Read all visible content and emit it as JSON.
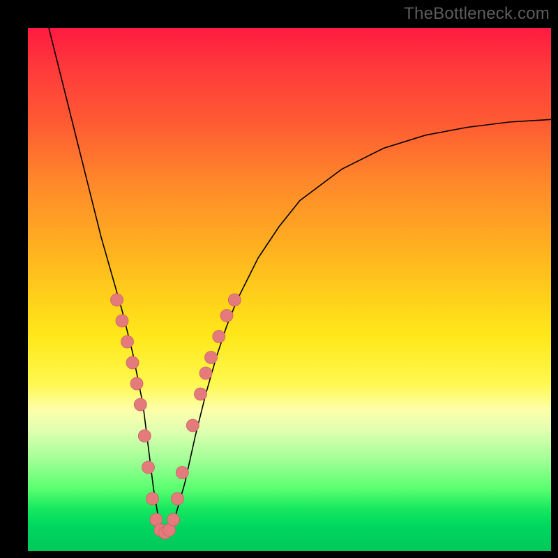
{
  "watermark": "TheBottleneck.com",
  "chart_data": {
    "type": "line",
    "title": "",
    "xlabel": "",
    "ylabel": "",
    "xlim": [
      0,
      100
    ],
    "ylim": [
      0,
      100
    ],
    "series": [
      {
        "name": "curve",
        "x": [
          4,
          6,
          8,
          10,
          12,
          14,
          16,
          18,
          20,
          22,
          23,
          24,
          25,
          26,
          27,
          28,
          30,
          32,
          34,
          36,
          38,
          40,
          44,
          48,
          52,
          56,
          60,
          68,
          76,
          84,
          92,
          100
        ],
        "y": [
          100,
          92,
          84,
          76,
          68,
          60,
          53,
          46,
          38,
          28,
          20,
          12,
          6,
          3,
          3,
          6,
          13,
          22,
          30,
          37,
          43,
          48,
          56,
          62,
          67,
          70,
          73,
          77,
          79.5,
          81,
          82,
          82.5
        ]
      }
    ],
    "scatter": [
      {
        "name": "highlight-points",
        "points": [
          {
            "x": 17.0,
            "y": 48
          },
          {
            "x": 18.0,
            "y": 44
          },
          {
            "x": 19.0,
            "y": 40
          },
          {
            "x": 20.0,
            "y": 36
          },
          {
            "x": 20.8,
            "y": 32
          },
          {
            "x": 21.5,
            "y": 28
          },
          {
            "x": 22.3,
            "y": 22
          },
          {
            "x": 23.0,
            "y": 16
          },
          {
            "x": 23.8,
            "y": 10
          },
          {
            "x": 24.5,
            "y": 6
          },
          {
            "x": 25.3,
            "y": 4
          },
          {
            "x": 26.2,
            "y": 3.5
          },
          {
            "x": 27.0,
            "y": 4
          },
          {
            "x": 27.8,
            "y": 6
          },
          {
            "x": 28.6,
            "y": 10
          },
          {
            "x": 29.5,
            "y": 15
          },
          {
            "x": 31.5,
            "y": 24
          },
          {
            "x": 33.0,
            "y": 30
          },
          {
            "x": 34.0,
            "y": 34
          },
          {
            "x": 35.0,
            "y": 37
          },
          {
            "x": 36.5,
            "y": 41
          },
          {
            "x": 38.0,
            "y": 45
          },
          {
            "x": 39.5,
            "y": 48
          }
        ]
      }
    ]
  },
  "colors": {
    "dot_fill": "#e47a7c",
    "dot_stroke": "#c96064",
    "curve_stroke": "#000000"
  }
}
